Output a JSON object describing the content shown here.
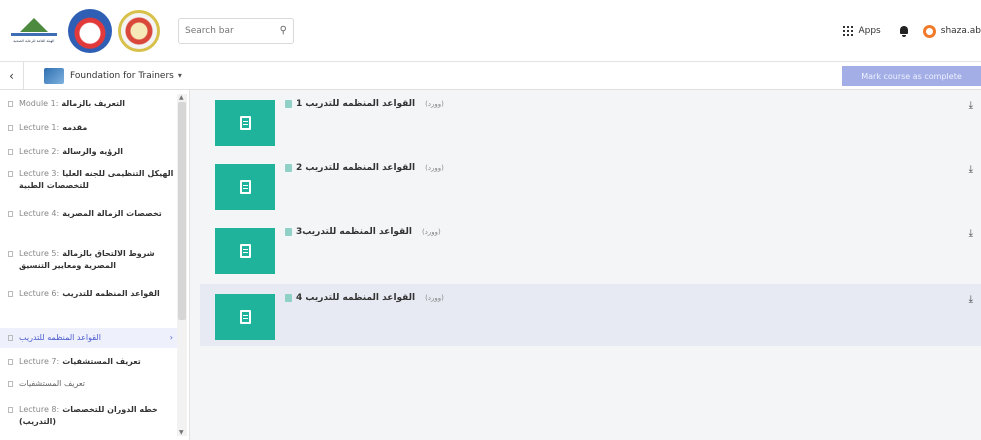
{
  "header": {
    "logo_caption": "الهيئة العامة للرعاية الصحية",
    "search_placeholder": "Search bar",
    "search_icon": "search-icon",
    "apps_label": "Apps",
    "user_name": "shaza.ab"
  },
  "course": {
    "title": "Foundation for Trainers",
    "caret": "▾",
    "back": "‹",
    "expand": "⤢",
    "mark_complete": "Mark course as complete"
  },
  "sidebar": {
    "items": [
      {
        "en": "Module 1:",
        "ar": "التعريف بالزمالة"
      },
      {
        "en": "Lecture 1:",
        "ar": "مقدمه"
      },
      {
        "en": "Lecture 2:",
        "ar": "الرؤيه والرسالة"
      },
      {
        "en": "Lecture 3:",
        "ar": "الهيكل التنظيمى للجنه العليا للتخصصات الطبية"
      },
      {
        "en": "Lecture 4:",
        "ar": "تخصصات الزمالة المصرية"
      },
      {
        "en": "Lecture 5:",
        "ar": "شروط الالتحاق بالزمالة المصرية ومعايير التنسيق"
      },
      {
        "en": "Lecture 6:",
        "ar": "القواعد المنظمه للتدريب"
      },
      {
        "en": "",
        "ar": "القواعد المنظمه للتدريب",
        "active": true
      },
      {
        "en": "Lecture 7:",
        "ar": "تعريف المستشفيات"
      },
      {
        "en": "",
        "ar": "تعريف المستشفيات"
      },
      {
        "en": "Lecture 8:",
        "ar": "خطه الدوران للتخصصات (التدريب)"
      }
    ]
  },
  "files": [
    {
      "name": "القواعد المنظمه للتدريب 1",
      "type": "(وورد)"
    },
    {
      "name": "القواعد المنظمه للتدريب 2",
      "type": "(وورد)"
    },
    {
      "name": "القواعد المنظمه للتدريب3",
      "type": "(وورد)"
    },
    {
      "name": "القواعد المنظمه للتدريب 4",
      "type": "(وورد)",
      "highlight": true
    }
  ],
  "icons": {
    "download": "⤓",
    "arrow_right": "›"
  },
  "colors": {
    "tile": "#1fb39b",
    "button": "#a3aee6",
    "active": "#4a5bd0"
  }
}
